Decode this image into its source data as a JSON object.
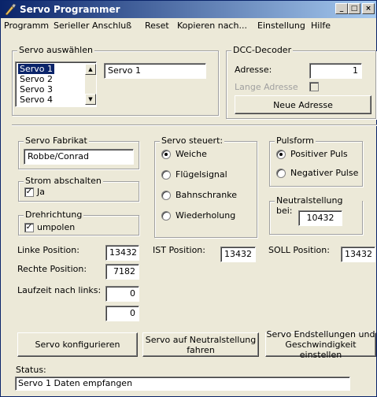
{
  "window": {
    "title": "Servo Programmer",
    "min": "_",
    "max": "□",
    "close": "×"
  },
  "menu": [
    "Programm",
    "Serieller Anschluß",
    "Reset",
    "Kopieren nach...",
    "Einstellung",
    "Hilfe"
  ],
  "servo_select": {
    "label": "Servo auswählen",
    "items": [
      "Servo 1",
      "Servo 2",
      "Servo 3",
      "Servo 4"
    ],
    "selected_name": "Servo 1"
  },
  "dcc": {
    "label": "DCC-Decoder",
    "address_label": "Adresse:",
    "address_value": "1",
    "long_address_label": "Lange Adresse",
    "new_address_button": "Neue Adresse"
  },
  "manufacturer": {
    "label": "Servo Fabrikat",
    "value": "Robbe/Conrad"
  },
  "power_off": {
    "label": "Strom abschalten",
    "check_label": "Ja"
  },
  "direction": {
    "label": "Drehrichtung",
    "check_label": "umpolen"
  },
  "controls": {
    "label": "Servo steuert:",
    "options": [
      "Weiche",
      "Flügelsignal",
      "Bahnschranke",
      "Wiederholung"
    ]
  },
  "pulse": {
    "label": "Pulsform",
    "options": [
      "Positiver Puls",
      "Negativer Pulse"
    ]
  },
  "neutral": {
    "label": "Neutralstellung bei:",
    "value": "10432"
  },
  "positions": {
    "left_label": "Linke Position:",
    "left_value": "13432",
    "right_label": "Rechte Position:",
    "right_value": "7182",
    "runtime_label": "Laufzeit nach links:",
    "runtime_value1": "0",
    "runtime_value2": "0",
    "ist_label": "IST Position:",
    "ist_value": "13432",
    "soll_label": "SOLL Position:",
    "soll_value": "13432"
  },
  "buttons": {
    "configure": "Servo konfigurieren",
    "neutral_move_1": "Servo auf Neutralstellung",
    "neutral_move_2": "fahren",
    "endpos_1": "Servo Endstellungen und",
    "endpos_2": "Geschwindigkeit einstellen"
  },
  "status": {
    "label": "Status:",
    "value": "Servo 1 Daten empfangen"
  }
}
